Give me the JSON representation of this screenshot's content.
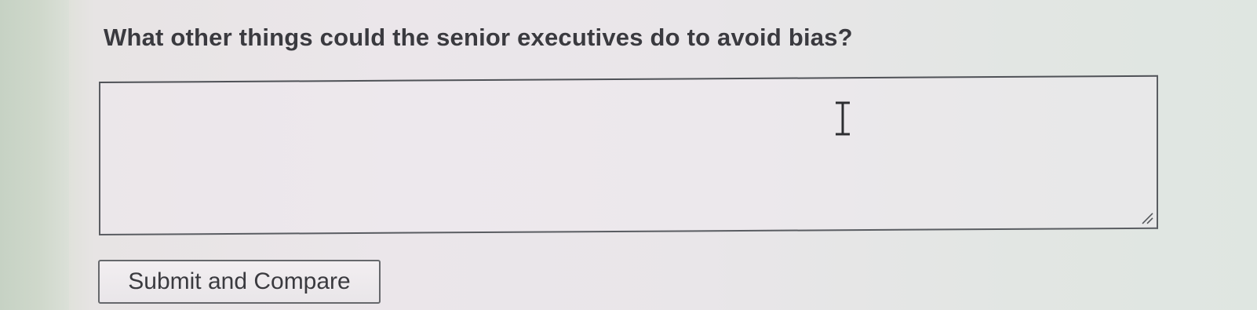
{
  "question": {
    "text": "What other things could the senior executives do to avoid bias?"
  },
  "answer": {
    "value": "",
    "placeholder": ""
  },
  "submit": {
    "label": "Submit and Compare"
  },
  "cursor": {
    "icon": "ibeam-cursor-icon"
  },
  "colors": {
    "text": "#3a3a3f",
    "border": "#5a5d62"
  }
}
